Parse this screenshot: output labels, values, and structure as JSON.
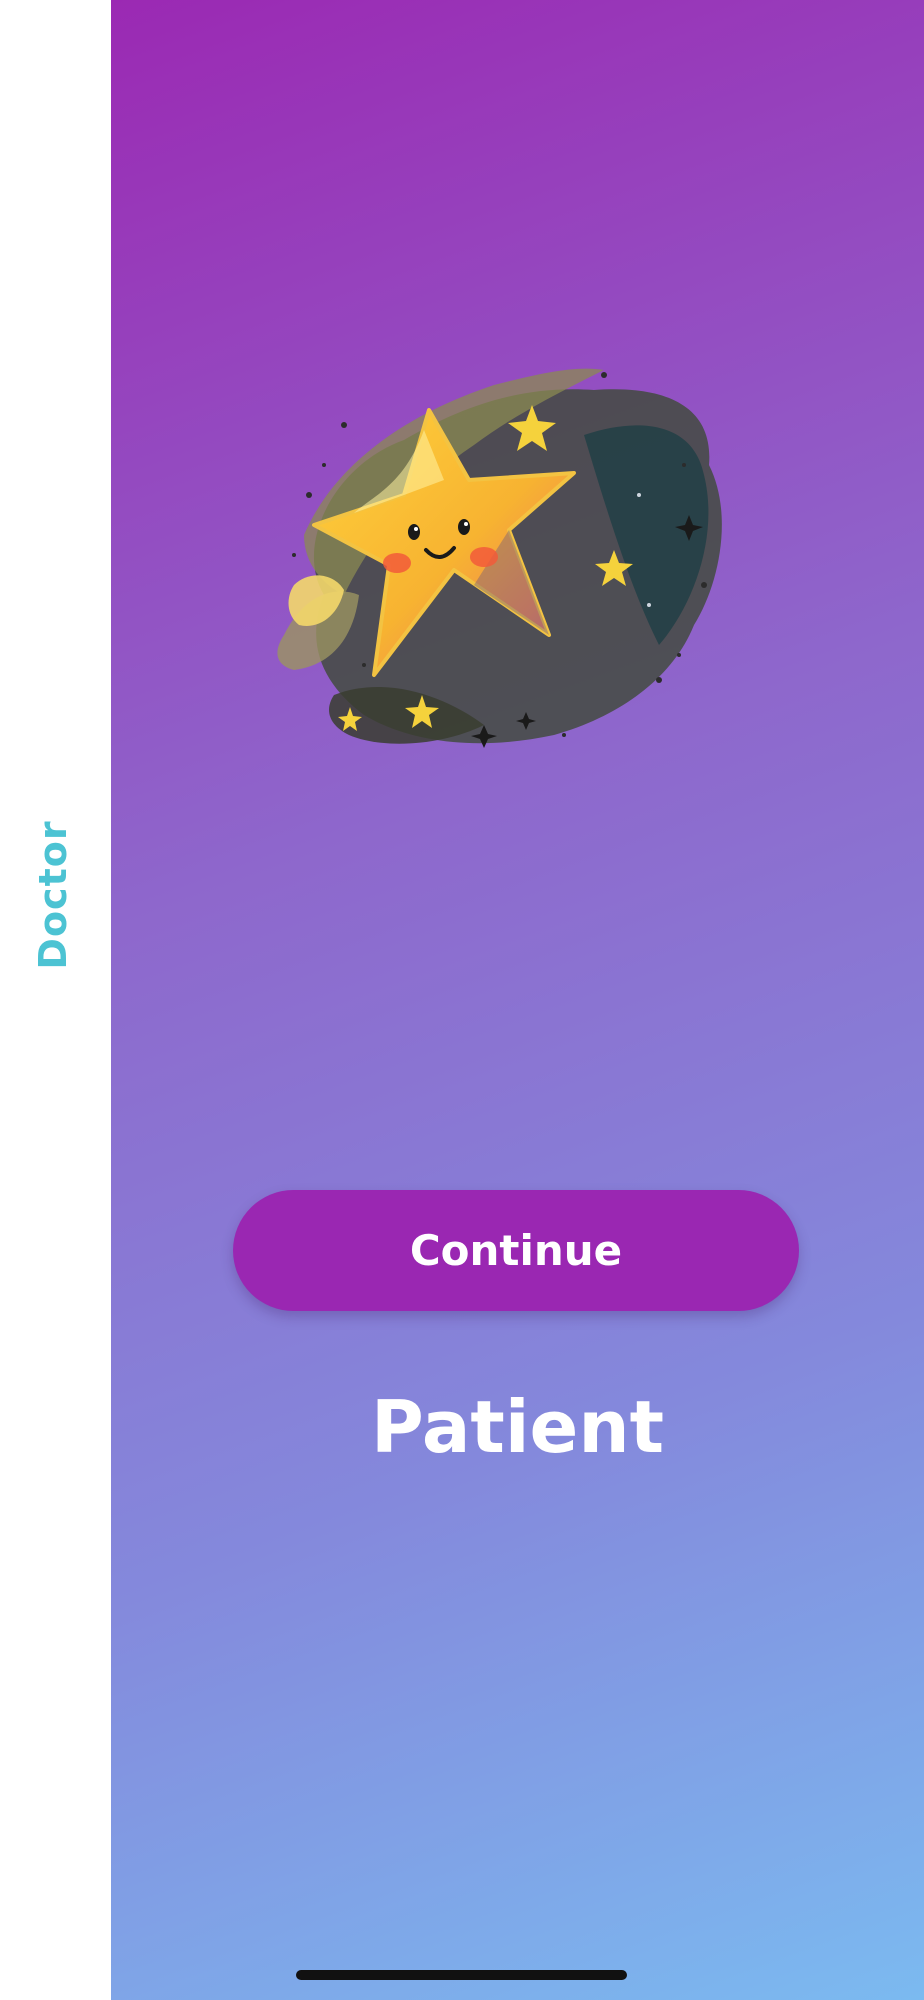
{
  "side_tab": {
    "label": "Doctor",
    "color": "#4cc3d3"
  },
  "main_panel": {
    "title": "Patient",
    "gradient_colors": [
      "#9b29b3",
      "#8e67cc",
      "#8489dc",
      "#7bbaf0"
    ],
    "illustration": "smiling-star-icon",
    "continue_button": {
      "label": "Continue",
      "color": "#9a27b2"
    }
  }
}
